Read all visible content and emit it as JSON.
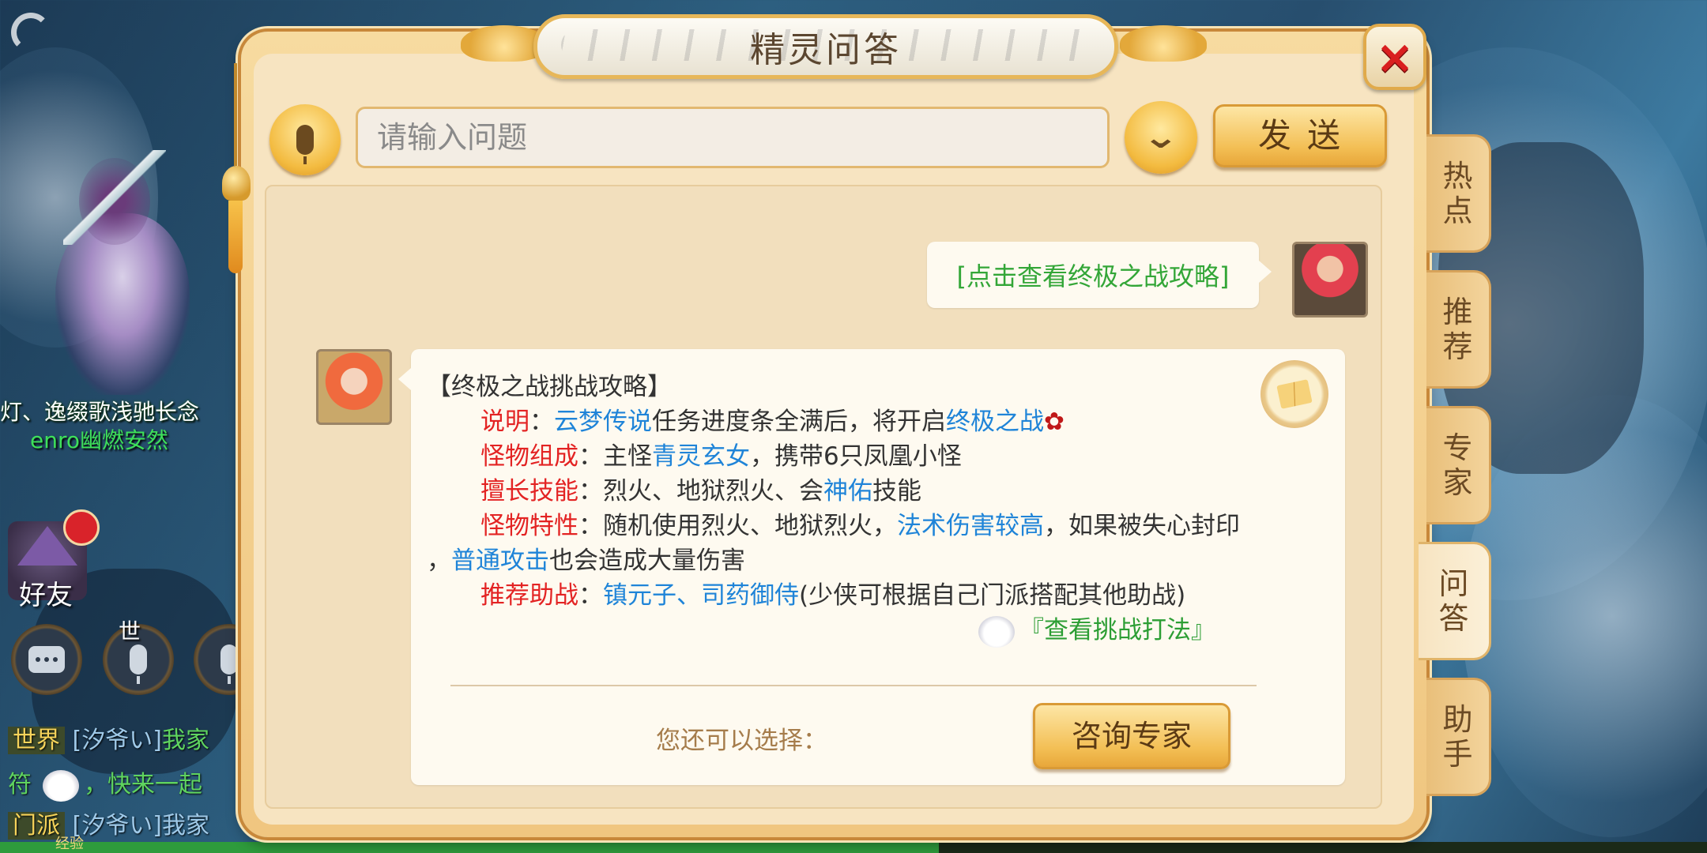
{
  "dialog": {
    "title": "精灵问答",
    "close_label": "×",
    "input_placeholder": "请输入问题",
    "send_label": "发送"
  },
  "conversation": {
    "user_message": "[点击查看终极之战攻略]",
    "answer": {
      "heading": "【终极之战挑战攻略】",
      "rows": [
        {
          "label": "说明",
          "sep": "：",
          "parts": [
            "云梦传说",
            "任务进度条全满后，将开启",
            "终极之战"
          ]
        },
        {
          "label": "怪物组成",
          "sep": "：",
          "parts": [
            "主怪",
            "青灵玄女",
            "，携带6只凤凰小怪"
          ]
        },
        {
          "label": "擅长技能",
          "sep": "：",
          "parts": [
            "烈火、地狱烈火、会",
            "神佑",
            "技能"
          ]
        },
        {
          "label": "怪物特性",
          "sep": "：",
          "parts": [
            "随机使用烈火、地狱烈火，",
            "法术伤害较高",
            "，如果被失心封印"
          ]
        },
        {
          "label": "",
          "sep": "",
          "parts": [
            "，",
            "普通攻击",
            "也会造成大量伤害"
          ]
        },
        {
          "label": "推荐助战",
          "sep": "：",
          "parts": [
            "镇元子、司药御侍",
            "(少侠可根据自己门派搭配其他助战)"
          ]
        }
      ],
      "link": "『查看挑战打法』",
      "choose_label": "您还可以选择：",
      "expert_button": "咨询专家"
    }
  },
  "side_tabs": [
    {
      "label": "热点",
      "active": false
    },
    {
      "label": "推荐",
      "active": false
    },
    {
      "label": "专家",
      "active": false
    },
    {
      "label": "问答",
      "active": true
    },
    {
      "label": "助手",
      "active": false
    }
  ],
  "game_overlay": {
    "player_name_top": "灯、逸缀歌浅驰长念",
    "player_name_bottom": "enro幽燃安然",
    "friend_label": "好友",
    "world_button_tag": "世",
    "chat_lines": [
      {
        "channel": "世界",
        "speaker": "[汐爷い]",
        "text": "我家"
      },
      {
        "channel": "",
        "speaker": "符",
        "text": "，快来一起"
      },
      {
        "channel": "门派",
        "speaker": "[汐爷い]",
        "text": "我家"
      }
    ],
    "exp_label": "经验",
    "exp_progress": 0.55
  }
}
